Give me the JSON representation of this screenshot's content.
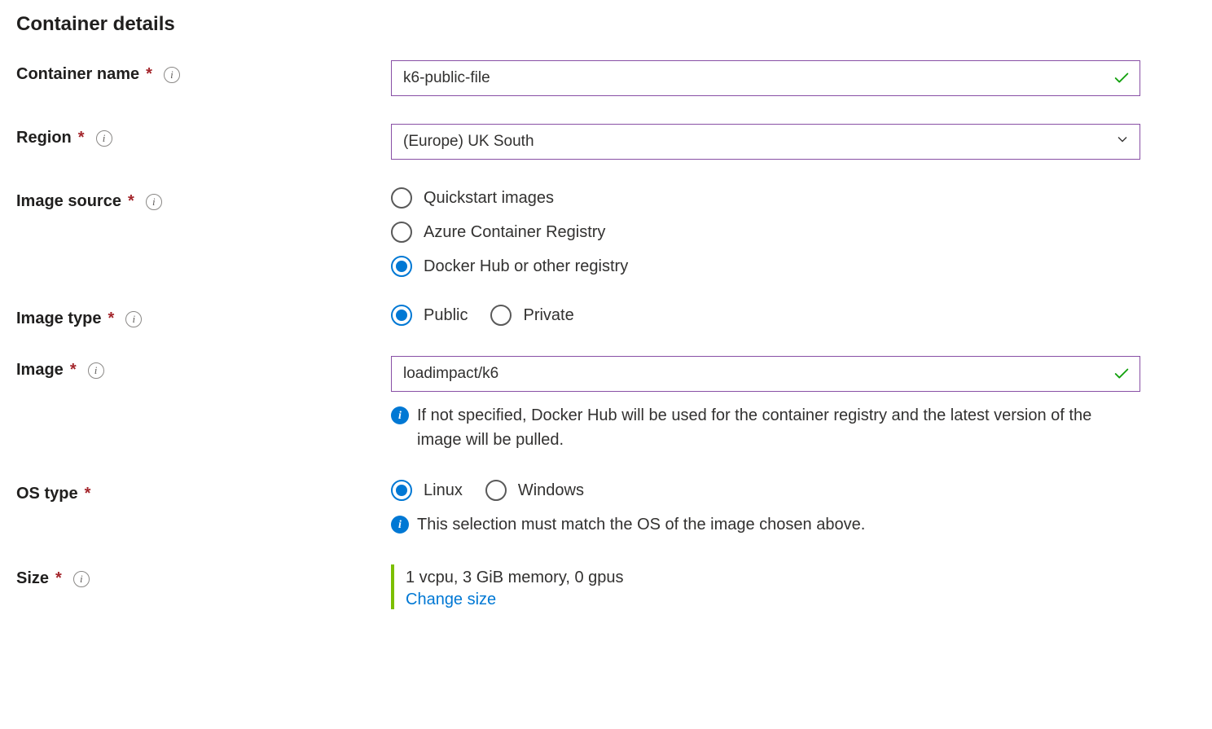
{
  "section_title": "Container details",
  "labels": {
    "container_name": "Container name",
    "region": "Region",
    "image_source": "Image source",
    "image_type": "Image type",
    "image": "Image",
    "os_type": "OS type",
    "size": "Size"
  },
  "container_name": {
    "value": "k6-public-file"
  },
  "region": {
    "selected": "(Europe) UK South"
  },
  "image_source": {
    "options": {
      "quickstart": "Quickstart images",
      "acr": "Azure Container Registry",
      "docker": "Docker Hub or other registry"
    },
    "selected": "docker"
  },
  "image_type": {
    "options": {
      "public": "Public",
      "private": "Private"
    },
    "selected": "public"
  },
  "image": {
    "value": "loadimpact/k6",
    "hint": "If not specified, Docker Hub will be used for the container registry and the latest version of the image will be pulled."
  },
  "os_type": {
    "options": {
      "linux": "Linux",
      "windows": "Windows"
    },
    "selected": "linux",
    "hint": "This selection must match the OS of the image chosen above."
  },
  "size": {
    "value": "1 vcpu, 3 GiB memory, 0 gpus",
    "change_link": "Change size"
  }
}
